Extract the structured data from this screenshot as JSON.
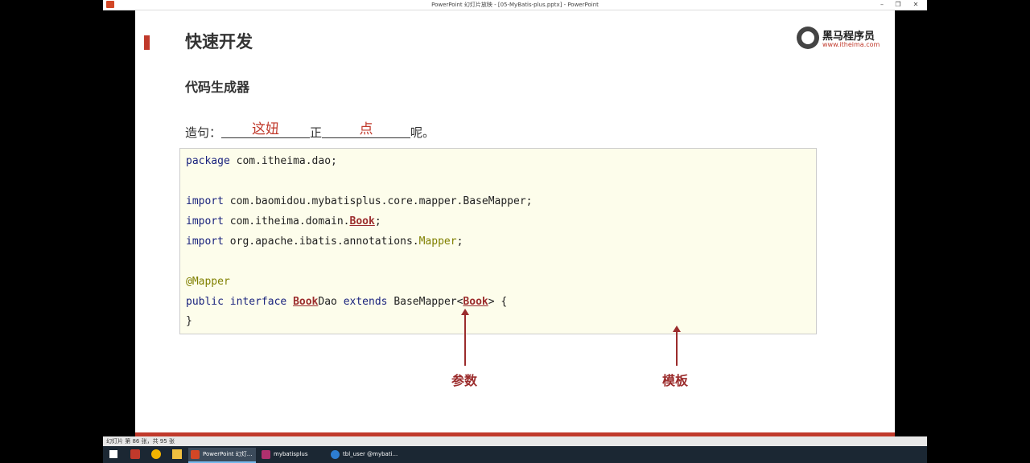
{
  "window": {
    "title": "PowerPoint 幻灯片放映 - [05-MyBatis-plus.pptx] - PowerPoint"
  },
  "slide": {
    "title": "快速开发",
    "subtitle": "代码生成器",
    "logo": {
      "cn": "黑马程序员",
      "url": "www.itheima.com"
    },
    "sentence": {
      "prefix": "造句：",
      "blank1": "这妞",
      "middle": "正",
      "blank2": "点",
      "suffix": "呢。"
    },
    "code": {
      "l1_kw": "package",
      "l1_rest": " com.itheima.dao;",
      "l3_kw": "import",
      "l3_rest": " com.baomidou.mybatisplus.core.mapper.BaseMapper;",
      "l4_kw": "import",
      "l4_rest": " com.itheima.domain.",
      "l4_hl": "Book",
      "l4_end": ";",
      "l5_kw": "import",
      "l5_rest": " org.apache.ibatis.annotations.",
      "l5_ann": "Mapper",
      "l5_end": ";",
      "l7_ann": "@Mapper",
      "l8_kw1": "public",
      "l8_kw2": "interface",
      "l8_hl": "Book",
      "l8_dao": "Dao ",
      "l8_kw3": "extends",
      "l8_base": " BaseMapper<",
      "l8_hl2": "Book",
      "l8_end": "> {",
      "l9": "}"
    },
    "labels": {
      "param": "参数",
      "template": "模板"
    }
  },
  "statusbar": {
    "text": "幻灯片 第 86 张，共 95 张",
    "zoom": ""
  },
  "taskbar": {
    "items": [
      {
        "label": "PowerPoint 幻灯..."
      },
      {
        "label": "mybatisplus"
      },
      {
        "label": "tbl_user @mybati..."
      }
    ]
  },
  "colors": {
    "accent": "#c0392b",
    "code_bg": "#fdfdeb",
    "keyword": "#1a237e",
    "annotation": "#808000"
  }
}
